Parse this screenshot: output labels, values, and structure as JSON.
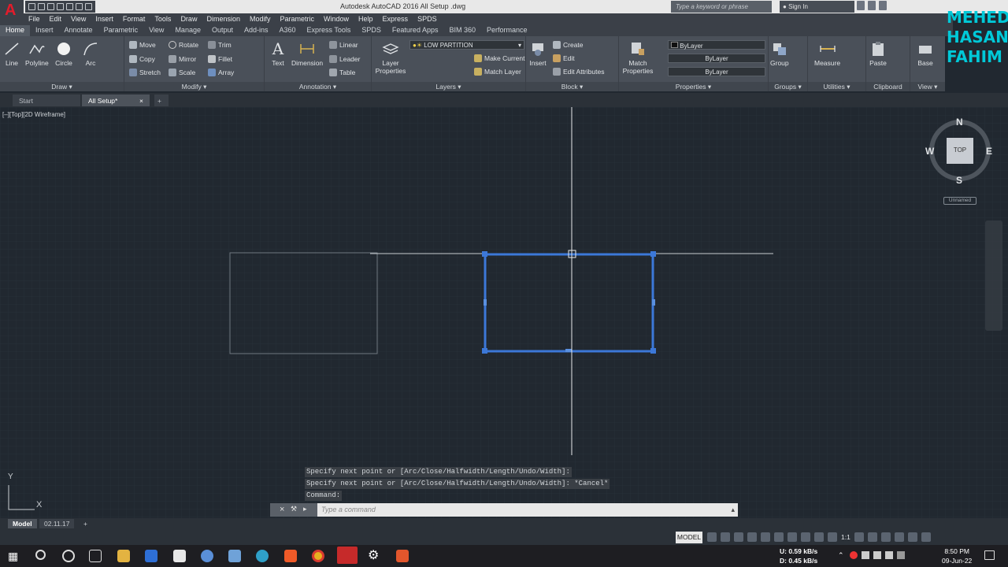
{
  "window": {
    "title": "Autodesk AutoCAD 2016    All Setup .dwg"
  },
  "search": {
    "placeholder": "Type a keyword or phrase"
  },
  "account": {
    "signin_label": "Sign In"
  },
  "menu": [
    "File",
    "Edit",
    "View",
    "Insert",
    "Format",
    "Tools",
    "Draw",
    "Dimension",
    "Modify",
    "Parametric",
    "Window",
    "Help",
    "Express",
    "SPDS"
  ],
  "ribbon_tabs": [
    "Home",
    "Insert",
    "Annotate",
    "Parametric",
    "View",
    "Manage",
    "Output",
    "Add-ins",
    "A360",
    "Express Tools",
    "SPDS",
    "Featured Apps",
    "BIM 360",
    "Performance"
  ],
  "ribbon": {
    "draw": {
      "title": "Draw",
      "line": "Line",
      "polyline": "Polyline",
      "circle": "Circle",
      "arc": "Arc"
    },
    "modify": {
      "title": "Modify",
      "move": "Move",
      "rotate": "Rotate",
      "trim": "Trim",
      "copy": "Copy",
      "mirror": "Mirror",
      "fillet": "Fillet",
      "stretch": "Stretch",
      "scale": "Scale",
      "array": "Array"
    },
    "annotation": {
      "title": "Annotation",
      "text": "Text",
      "dimension": "Dimension",
      "linear": "Linear",
      "leader": "Leader",
      "table": "Table"
    },
    "layers": {
      "title": "Layers",
      "layer_properties": "Layer Properties",
      "current_layer": "LOW PARTITION",
      "make_current": "Make Current",
      "match_layer": "Match Layer"
    },
    "block": {
      "title": "Block",
      "insert": "Insert",
      "create": "Create",
      "edit": "Edit",
      "edit_attributes": "Edit Attributes"
    },
    "properties": {
      "title": "Properties",
      "match_properties": "Match Properties",
      "color": "ByLayer",
      "linetype": "ByLayer",
      "lineweight": "ByLayer"
    },
    "groups": {
      "title": "Groups",
      "group": "Group"
    },
    "utilities": {
      "title": "Utilities",
      "measure": "Measure"
    },
    "clipboard": {
      "title": "Clipboard",
      "paste": "Paste"
    },
    "view": {
      "title": "View",
      "base": "Base"
    }
  },
  "file_tabs": {
    "start": "Start",
    "current": "All Setup*"
  },
  "viewport": {
    "label": "[–][Top][2D Wireframe]"
  },
  "viewcube": {
    "face": "TOP",
    "north": "N",
    "south": "S",
    "east": "E",
    "west": "W",
    "ucs": "Unnamed"
  },
  "ucs_icon": {
    "y": "Y",
    "x": "X"
  },
  "command": {
    "history": [
      "Specify next point or [Arc/Close/Halfwidth/Length/Undo/Width]:",
      "Specify next point or [Arc/Close/Halfwidth/Length/Undo/Width]: *Cancel*",
      "Command:"
    ],
    "placeholder": "Type a command"
  },
  "layout_tabs": [
    "Model",
    "02.11.17"
  ],
  "status": {
    "model": "MODEL",
    "scale": "1:1"
  },
  "network": {
    "up": "U:  0.59 kB/s",
    "down": "D:  0.45 kB/s"
  },
  "clock": {
    "time": "8:50 PM",
    "date": "09-Jun-22"
  },
  "watermark": [
    "MEHEDI",
    "HASAN",
    "FAHIM"
  ],
  "colors": {
    "canvas": "#212830",
    "ribbon": "#4a5059",
    "selection": "#3c78d8",
    "accent": "#e21c2b",
    "watermark": "#00c9d8"
  }
}
